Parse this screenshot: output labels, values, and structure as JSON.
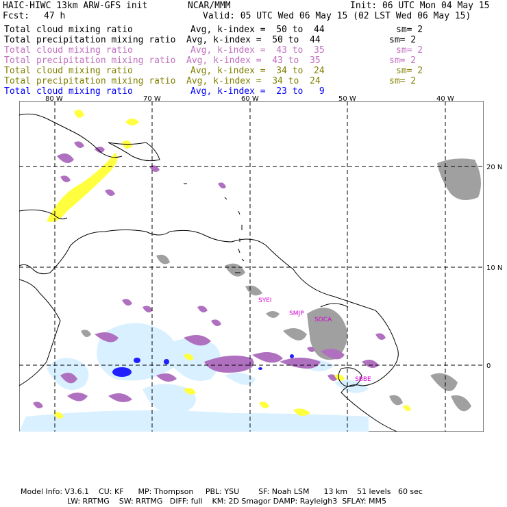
{
  "header": {
    "title_left": "HAIC-HIWC 13km ARW-GFS init",
    "title_mid": "NCAR/MMM",
    "init": "Init: 06 UTC Mon 04 May 15",
    "fcst_label": "Fcst:",
    "fcst_value": "47 h",
    "valid": "Valid: 05 UTC Wed 06 May 15 (02 LST Wed 06 May 15)"
  },
  "fields": [
    {
      "name": "Total cloud mixing ratio",
      "range": "Avg, k-index =  50 to  44",
      "sm": "sm= 2",
      "color": "#000000"
    },
    {
      "name": "Total precipitation mixing ratio",
      "range": "Avg, k-index =  50 to  44",
      "sm": "sm= 2",
      "color": "#000000"
    },
    {
      "name": "Total cloud mixing ratio",
      "range": "Avg, k-index =  43 to  35",
      "sm": "sm= 2",
      "color": "#c070c0"
    },
    {
      "name": "Total precipitation mixing ratio",
      "range": "Avg, k-index =  43 to  35",
      "sm": "sm= 2",
      "color": "#c070c0"
    },
    {
      "name": "Total cloud mixing ratio",
      "range": "Avg, k-index =  34 to  24",
      "sm": "sm= 2",
      "color": "#808000"
    },
    {
      "name": "Total precipitation mixing ratio",
      "range": "Avg, k-index =  34 to  24",
      "sm": "sm= 2",
      "color": "#808000"
    },
    {
      "name": "Total cloud mixing ratio",
      "range": "Avg, k-index =  23 to   9",
      "sm": "",
      "color": "#0000ff"
    }
  ],
  "map": {
    "lon_labels": [
      "80 W",
      "70 W",
      "60 W",
      "50 W",
      "40 W"
    ],
    "lat_labels": [
      "20 N",
      "10 N",
      "0"
    ],
    "stations": [
      "SYEI",
      "SMJP",
      "SOCA",
      "SBBE"
    ],
    "colors": {
      "gray": "#a0a0a0",
      "purple": "#b070c0",
      "yellow": "#ffff40",
      "lightblue": "#d8f0ff",
      "blue": "#2020ff"
    }
  },
  "footer": {
    "line1": "Model Info: V3.6.1    CU: KF      MP: Thompson     PBL: YSU        SF: Noah LSM      13 km    51 levels   60 sec",
    "line2": "LW: RRTMG    SW: RRTMG   DIFF: full    KM: 2D Smagor DAMP: Rayleigh3  SFLAY: MM5"
  }
}
